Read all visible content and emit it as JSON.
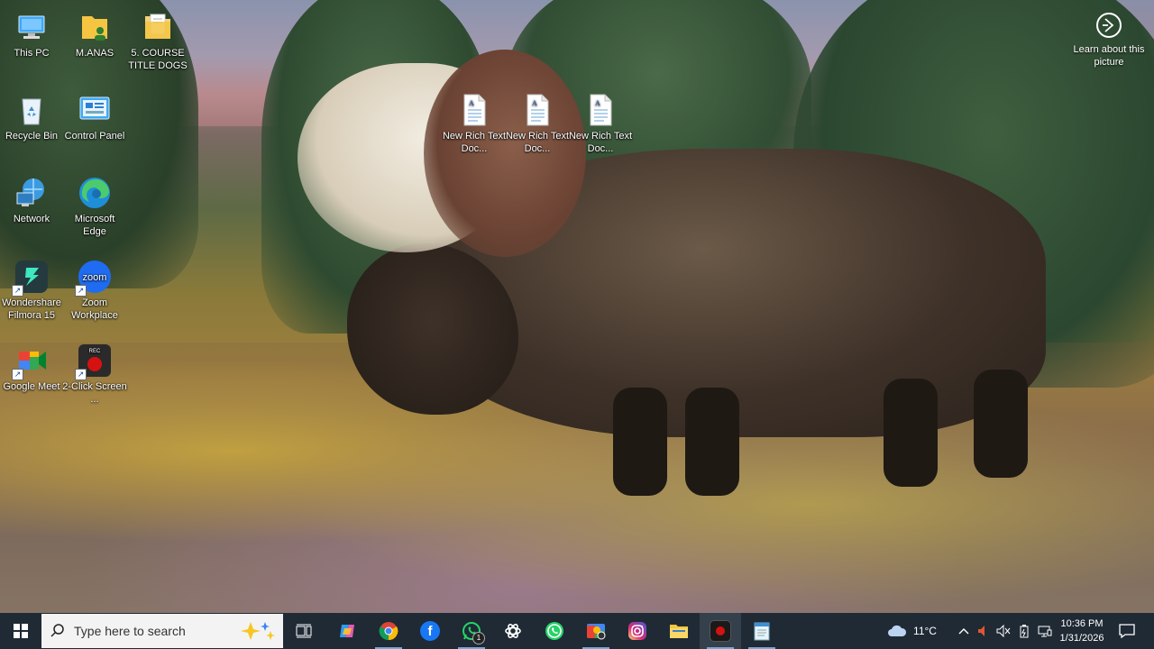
{
  "desktop": {
    "icons": [
      {
        "label": "This PC",
        "icon": "computer-icon"
      },
      {
        "label": "M.ANAS",
        "icon": "user-folder-icon"
      },
      {
        "label": "5. COURSE TITLE DOGS",
        "icon": "folder-icon"
      },
      {
        "label": "Recycle Bin",
        "icon": "recycle-bin-icon"
      },
      {
        "label": "Control Panel",
        "icon": "control-panel-icon"
      },
      {
        "label": "Network",
        "icon": "network-icon"
      },
      {
        "label": "Microsoft Edge",
        "icon": "edge-icon"
      },
      {
        "label": "Wondershare Filmora 15",
        "icon": "filmora-icon"
      },
      {
        "label": "Zoom Workplace",
        "icon": "zoom-icon"
      },
      {
        "label": "Google Meet",
        "icon": "google-meet-icon"
      },
      {
        "label": "2-Click Screen ...",
        "icon": "screen-recorder-icon"
      },
      {
        "label": "New Rich Text Doc...",
        "icon": "rtf-document-icon"
      },
      {
        "label": "New Rich Text Doc...",
        "icon": "rtf-document-icon"
      },
      {
        "label": "New Rich Text Doc...",
        "icon": "rtf-document-icon"
      }
    ],
    "zoom_icon_text": "zoom",
    "rec_icon_text": "REC"
  },
  "spotlight": {
    "label": "Learn about this picture",
    "icon": "camera-info-icon"
  },
  "taskbar": {
    "search_placeholder": "Type here to search",
    "apps": [
      {
        "name": "Task View",
        "icon": "task-view-icon",
        "color": "#1f2a35"
      },
      {
        "name": "Copilot",
        "icon": "copilot-icon",
        "color": "#c85ad6"
      },
      {
        "name": "Google Chrome",
        "icon": "chrome-icon",
        "color": "#db4437"
      },
      {
        "name": "Facebook",
        "icon": "facebook-icon",
        "color": "#1877f2"
      },
      {
        "name": "WhatsApp",
        "icon": "whatsapp-icon",
        "color": "#25d366"
      },
      {
        "name": "ChatGPT",
        "icon": "chatgpt-icon",
        "color": "#1f2a35"
      },
      {
        "name": "WhatsApp",
        "icon": "whatsapp-icon",
        "color": "#25d366"
      },
      {
        "name": "Google Chrome profile",
        "icon": "chrome-icon",
        "color": "#fbbc05"
      },
      {
        "name": "Instagram",
        "icon": "instagram-icon",
        "color": "#d62976"
      },
      {
        "name": "File Explorer",
        "icon": "file-explorer-icon",
        "color": "#f5c542"
      },
      {
        "name": "2-Click Screen Recorder",
        "icon": "screen-recorder-icon",
        "color": "#cc1111"
      },
      {
        "name": "Notepad",
        "icon": "notepad-icon",
        "color": "#3d8fd6"
      }
    ],
    "whatsapp_badge": "1",
    "weather": {
      "temp": "11°C",
      "icon": "cloud-icon"
    },
    "clock": {
      "time": "10:36 PM",
      "date": "1/31/2026"
    }
  }
}
